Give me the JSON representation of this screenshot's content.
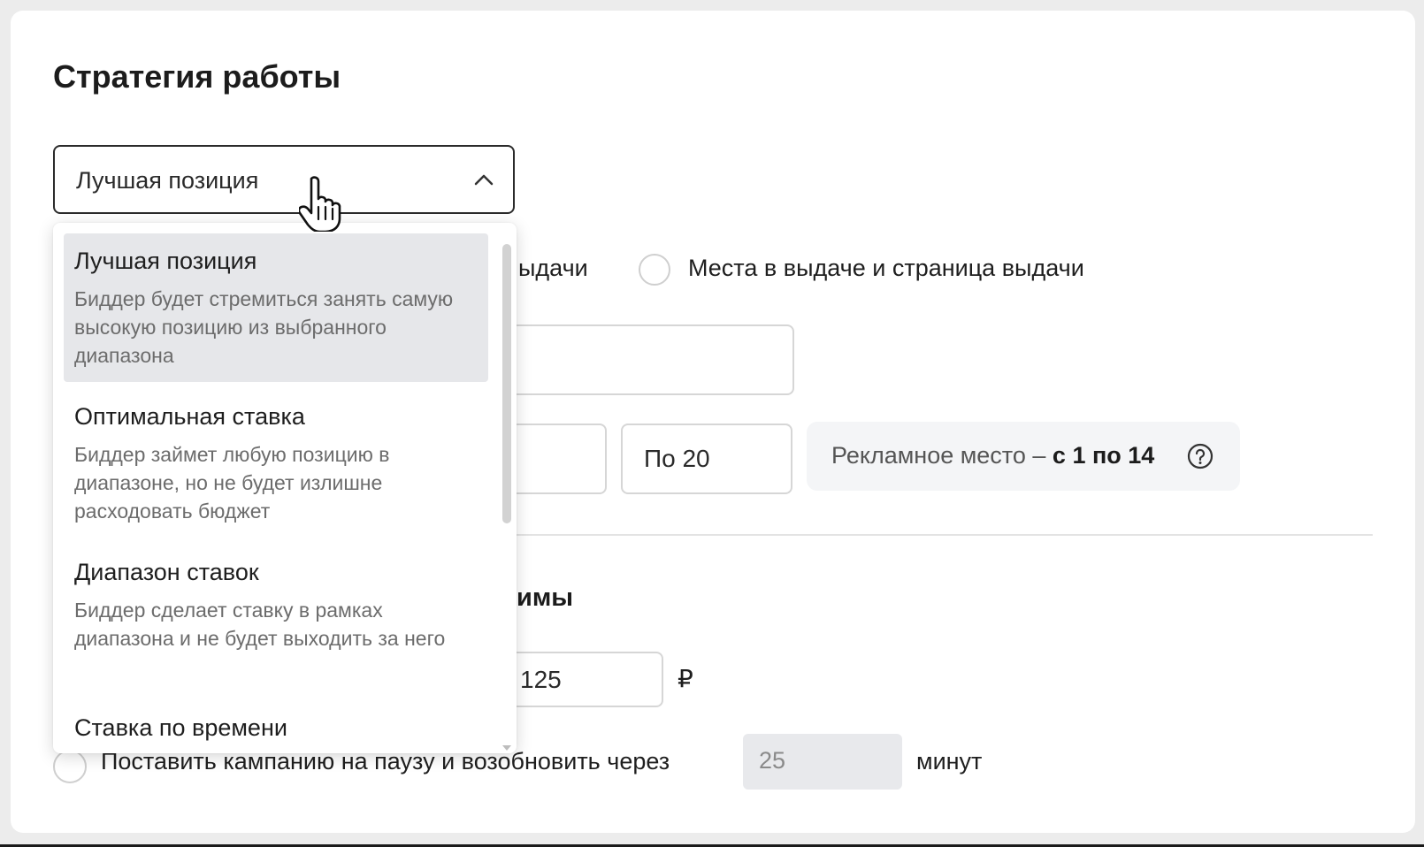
{
  "title": "Стратегия работы",
  "strategy_select": {
    "value": "Лучшая позиция"
  },
  "placement": {
    "option1_partial": "ыдачи",
    "option2": "Места в выдаче и страница выдачи"
  },
  "range": {
    "to_value": "По 20"
  },
  "info": {
    "prefix": "Рекламное место – ",
    "value": "с 1 по 14"
  },
  "limits": {
    "section_title_partial": "имы",
    "bid_value": "125",
    "currency": "₽"
  },
  "pause": {
    "label": "Поставить кампанию на паузу и возобновить через",
    "minutes_placeholder": "25",
    "unit": "минут"
  },
  "dropdown": {
    "options": [
      {
        "title": "Лучшая позиция",
        "desc": "Биддер будет стремиться занять самую высокую позицию из выбранного диапазона"
      },
      {
        "title": "Оптимальная ставка",
        "desc": "Биддер займет любую позицию в диапазоне, но не будет излишне расходовать бюджет"
      },
      {
        "title": "Диапазон ставок",
        "desc": "Биддер сделает ставку в рамках диапазона и не будет выходить за него"
      },
      {
        "title": "Ставка по времени",
        "desc": ""
      }
    ]
  },
  "icons": {
    "chevron": "chevron-up-icon",
    "help": "question-circle-icon",
    "cursor": "hand-pointer-icon"
  }
}
